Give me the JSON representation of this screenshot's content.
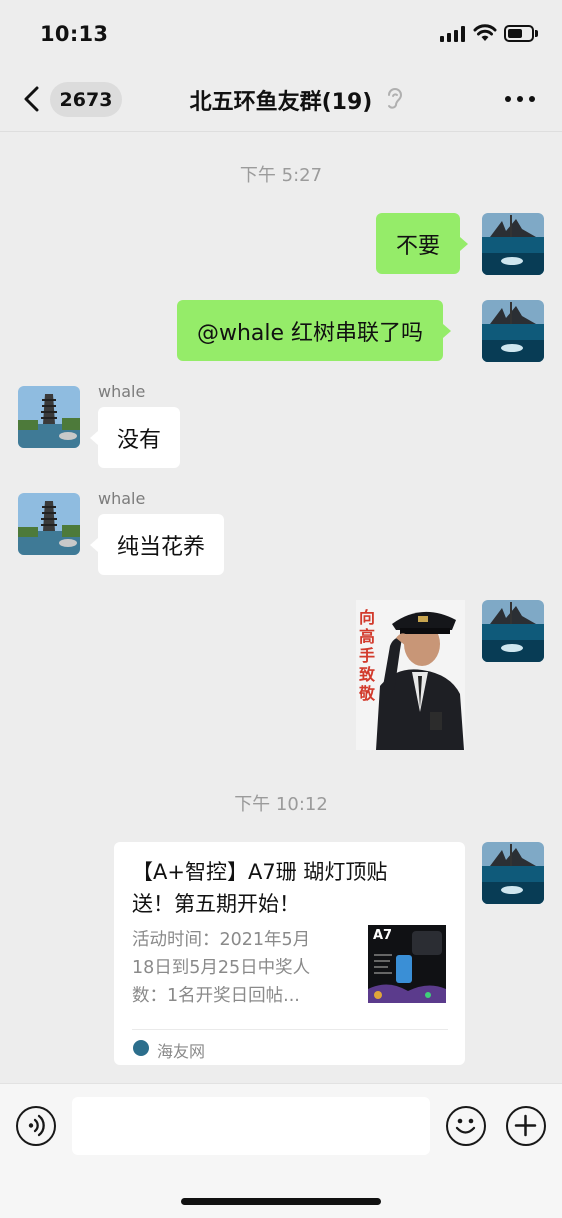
{
  "status_bar": {
    "time": "10:13"
  },
  "nav": {
    "back_count": "2673",
    "title": "北五环鱼友群(19)"
  },
  "messages": [
    {
      "type": "timestamp",
      "text": "下午 5:27"
    },
    {
      "type": "text",
      "side": "right",
      "text": "不要"
    },
    {
      "type": "text",
      "side": "right",
      "text": "@whale 红树串联了吗"
    },
    {
      "type": "text",
      "side": "left",
      "sender": "whale",
      "text": "没有"
    },
    {
      "type": "text",
      "side": "left",
      "sender": "whale",
      "text": "纯当花养"
    },
    {
      "type": "sticker",
      "side": "right",
      "caption": "向高手致敬"
    },
    {
      "type": "timestamp",
      "text": "下午 10:12"
    },
    {
      "type": "link",
      "side": "right",
      "title": "【A+智控】A7珊 瑚灯顶贴\n送！第五期开始！",
      "desc": "活动时间：2021年5月\n18日到5月25日中奖人\n数：1名开奖日回帖...",
      "thumb_label": "A7",
      "source": "海友网"
    }
  ],
  "icons": {
    "back": "chevron-left-icon",
    "ear": "ear-icon",
    "more": "more-dots-icon",
    "voice": "voice-icon",
    "emoji": "emoji-icon",
    "plus": "plus-icon"
  },
  "colors": {
    "bubble_self": "#95ec69",
    "bubble_other": "#ffffff",
    "background": "#ededed"
  }
}
